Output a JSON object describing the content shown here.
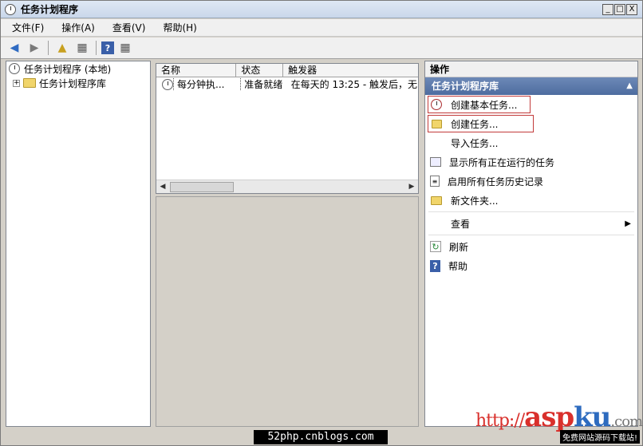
{
  "window": {
    "title": "任务计划程序",
    "buttons": {
      "minimize": "_",
      "maximize": "□",
      "close": "X"
    }
  },
  "menu": [
    "文件(F)",
    "操作(A)",
    "查看(V)",
    "帮助(H)"
  ],
  "tree": {
    "root": "任务计划程序 (本地)",
    "child": "任务计划程序库",
    "expander": "+"
  },
  "table": {
    "columns": [
      "名称",
      "状态",
      "触发器"
    ],
    "rows": [
      {
        "name": "每分钟执...",
        "status": "准备就绪",
        "trigger": "在每天的 13:25 - 触发后，无"
      }
    ]
  },
  "actions": {
    "header": "操作",
    "section": "任务计划程序库",
    "items": [
      {
        "label": "创建基本任务...",
        "icon": "create-basic-task-icon"
      },
      {
        "label": "创建任务...",
        "icon": "create-task-icon"
      },
      {
        "label": "导入任务...",
        "icon": ""
      },
      {
        "label": "显示所有正在运行的任务",
        "icon": "running-tasks-icon"
      },
      {
        "label": "启用所有任务历史记录",
        "icon": "history-icon"
      },
      {
        "label": "新文件夹...",
        "icon": "new-folder-icon"
      },
      {
        "label": "查看",
        "icon": ""
      },
      {
        "label": "刷新",
        "icon": "refresh-icon"
      },
      {
        "label": "帮助",
        "icon": "help-icon"
      }
    ]
  },
  "watermark": {
    "site": "52php.cnblogs.com",
    "brand_red": "http://",
    "brand_asp": "asp",
    "brand_ku": "ku",
    "brand_tail": ".com",
    "tagline": "免费网站源码下载站!"
  },
  "colors": {
    "accent": "#4d6c9f",
    "highlight_box": "#c23a3a"
  }
}
